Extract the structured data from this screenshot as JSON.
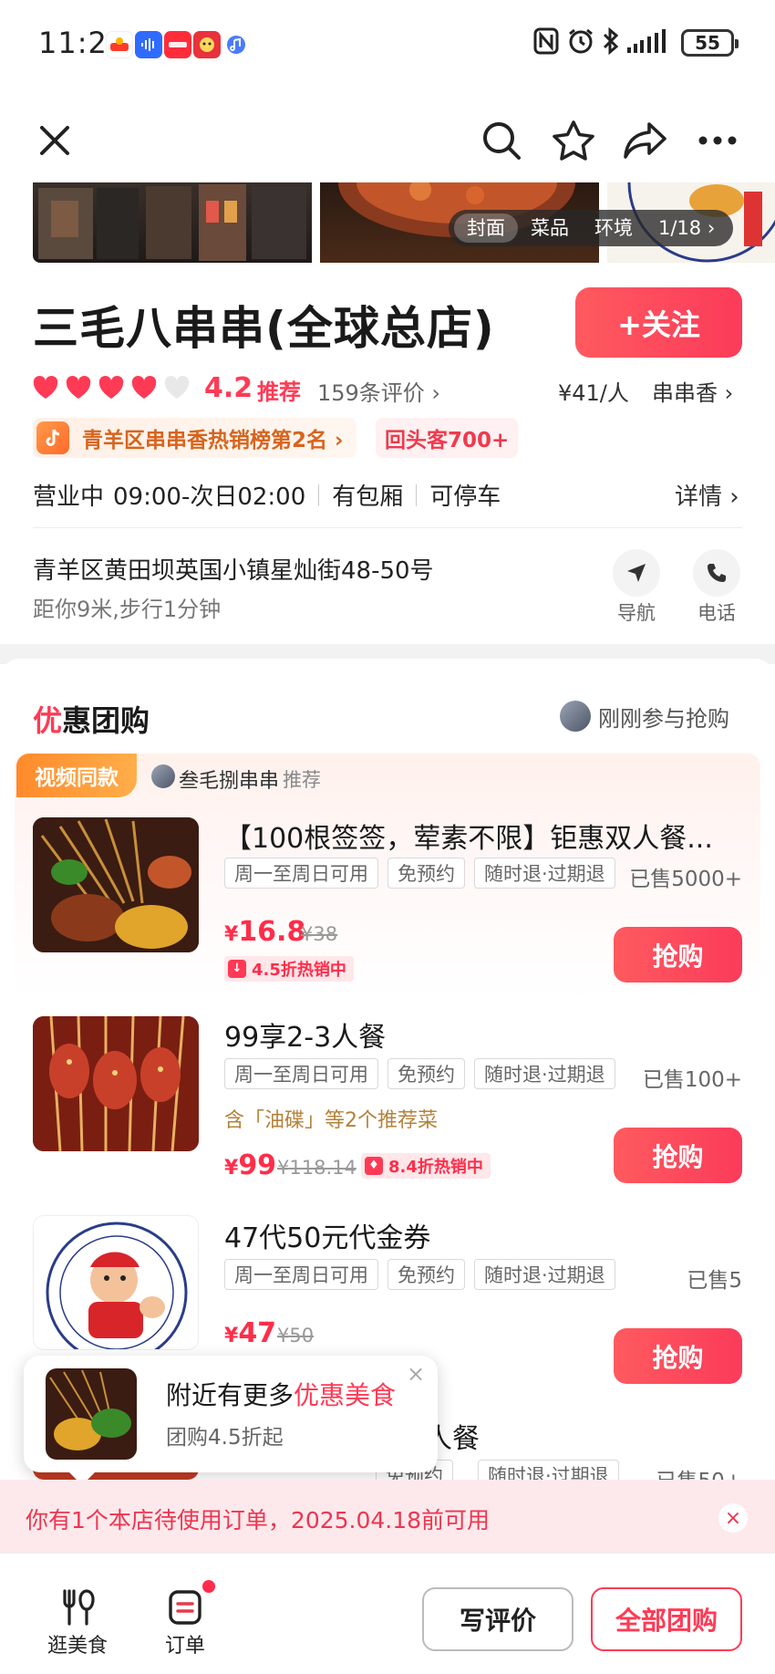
{
  "status_bar": {
    "time": "11:21",
    "battery": "55"
  },
  "photo_tabs": [
    "封面",
    "菜品",
    "环境",
    "1/18 ›"
  ],
  "shop": {
    "name": "三毛八串串(全球总店)",
    "follow_label": "+关注",
    "rating": "4.2",
    "rating_word": "推荐",
    "hearts_filled": 4,
    "hearts_total": 5,
    "reviews": "159条评价 ›",
    "price_per_person": "¥41/人",
    "category": "串串香 ›",
    "rank_badge": "青羊区串串香热销榜第2名 ›",
    "regulars_badge": "回头客700+",
    "open_status": "营业中",
    "hours": "09:00-次日02:00",
    "feature1": "有包厢",
    "feature2": "可停车",
    "details_link": "详情 ›",
    "address": "青羊区黄田坝英国小镇星灿街48-50号",
    "distance": "距你9米,步行1分钟",
    "nav_label": "导航",
    "phone_label": "电话"
  },
  "section": {
    "title_first": "优",
    "title_rest": "惠团购",
    "just_joined": "刚刚参与抢购"
  },
  "deal1": {
    "video_tag": "视频同款",
    "recommender": "叁毛捌串串",
    "recommend_word": "推荐",
    "name": "【100根签签，荤素不限】钜惠双人餐...",
    "chips": [
      "周一至周日可用",
      "免预约",
      "随时退·过期退"
    ],
    "sold": "已售5000+",
    "currency": "¥",
    "price": "16.8",
    "orig_price": "¥38",
    "hot": "4.5折热销中",
    "buy": "抢购"
  },
  "deal2": {
    "name": "99享2-3人餐",
    "chips": [
      "周一至周日可用",
      "免预约",
      "随时退·过期退"
    ],
    "sold": "已售100+",
    "contains": "含「油碟」等2个推荐菜",
    "currency": "¥",
    "price": "99",
    "orig_price": "¥118.14",
    "hot": "8.4折热销中",
    "buy": "抢购"
  },
  "deal3": {
    "name": "47代50元代金券",
    "chips": [
      "周一至周日可用",
      "免预约",
      "随时退·过期退"
    ],
    "sold": "已售5",
    "currency": "¥",
    "price": "47",
    "orig_price": "¥50",
    "buy": "抢购"
  },
  "deal4": {
    "name_partial": "人餐",
    "chip_partial": "随时退·过期退",
    "chip_partial2": "免预约",
    "sold": "已售50+"
  },
  "popup": {
    "title_prefix": "附近有更多",
    "title_highlight": "优惠美食",
    "subtitle": "团购4.5折起",
    "close": "×"
  },
  "notice": {
    "text": "你有1个本店待使用订单，2025.04.18前可用",
    "close": "×"
  },
  "bottom_nav": {
    "tab1": "逛美食",
    "tab2": "订单",
    "write_review": "写评价",
    "all_deals": "全部团购"
  },
  "colors": {
    "accent": "#ff3a55",
    "orange": "#ff8a2b",
    "text": "#1a1a1a"
  }
}
